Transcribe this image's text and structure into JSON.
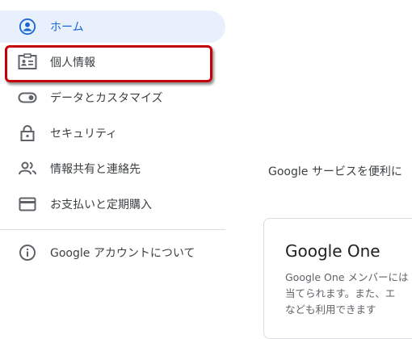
{
  "sidebar": {
    "items": [
      {
        "label": "ホーム",
        "icon": "account-circle-icon",
        "active": true
      },
      {
        "label": "個人情報",
        "icon": "id-card-icon"
      },
      {
        "label": "データとカスタマイズ",
        "icon": "toggle-icon"
      },
      {
        "label": "セキュリティ",
        "icon": "lock-icon"
      },
      {
        "label": "情報共有と連絡先",
        "icon": "people-icon"
      },
      {
        "label": "お支払いと定期購入",
        "icon": "credit-card-icon"
      }
    ],
    "about": {
      "label": "Google アカウントについて",
      "icon": "info-icon"
    }
  },
  "main": {
    "intro_text": "Google サービスを便利に",
    "card": {
      "title": "Google One",
      "desc_lines": [
        "Google One メンバーには",
        "当てられます。また、エ",
        "なども利用できます"
      ]
    }
  },
  "colors": {
    "active_bg": "#e8f0fe",
    "active_text": "#1967d2",
    "highlight": "#c5000b",
    "icon_gray": "#5f6368"
  }
}
